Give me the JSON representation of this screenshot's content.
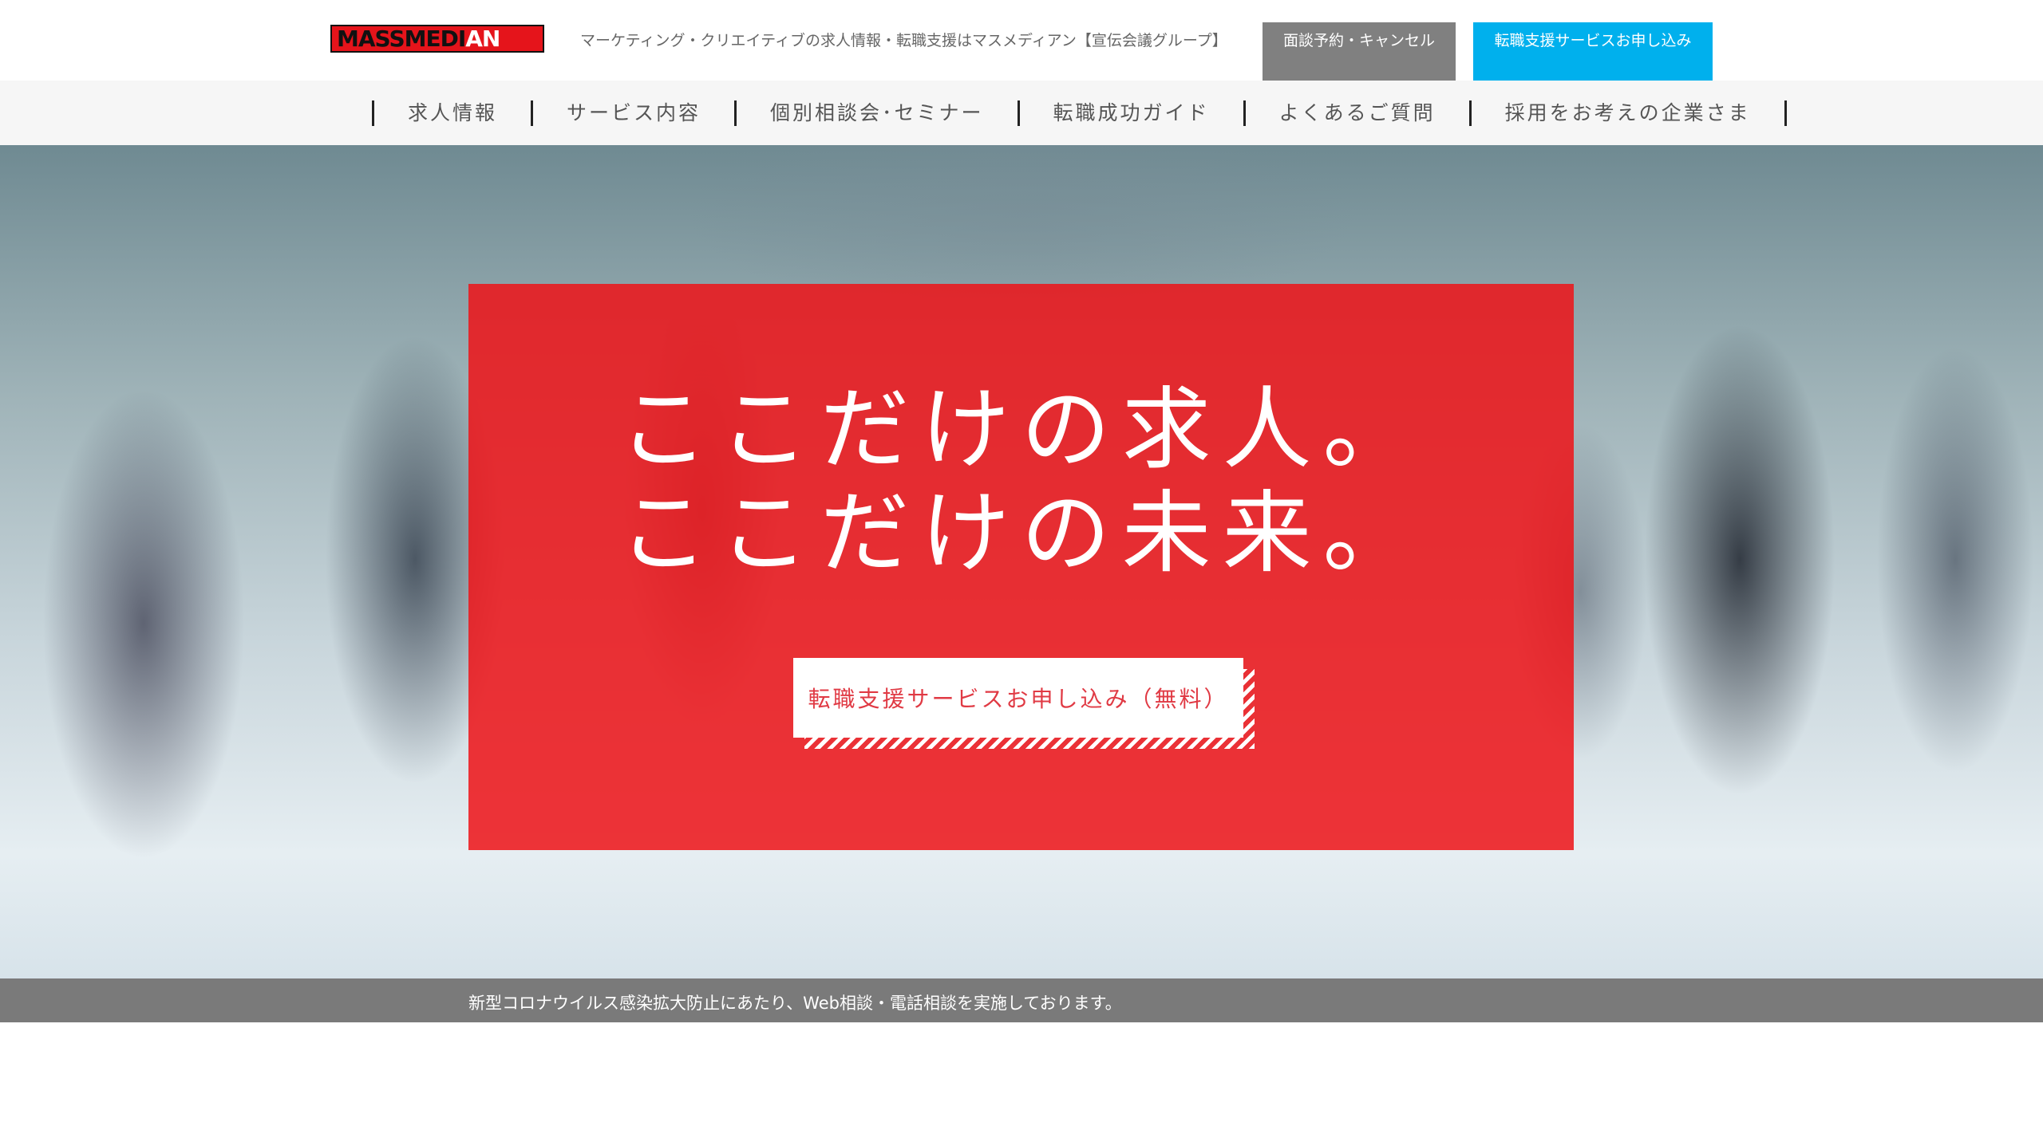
{
  "header": {
    "logo_dark": "MASSMEDI",
    "logo_light": "AN",
    "tagline": "マーケティング・クリエイティブの求人情報・転職支援はマスメディアン【宣伝会議グループ】",
    "btn_interview": "面談予約・キャンセル",
    "btn_apply": "転職支援サービスお申し込み"
  },
  "nav": {
    "items": [
      {
        "label": "求人情報"
      },
      {
        "label": "サービス内容"
      },
      {
        "label": "個別相談会･セミナー"
      },
      {
        "label": "転職成功ガイド"
      },
      {
        "label": "よくあるご質問"
      },
      {
        "label": "採用をお考えの企業さま"
      }
    ]
  },
  "hero": {
    "headline_line1": "ここだけの求人。",
    "headline_line2": "ここだけの未来。",
    "cta_label": "転職支援サービスお申し込み（無料）"
  },
  "notice": {
    "text": "新型コロナウイルス感染拡大防止にあたり、Web相談・電話相談を実施しております。"
  },
  "colors": {
    "brand_red": "#e5141b",
    "accent_blue": "#00b0ed",
    "gray_button": "#808080"
  }
}
